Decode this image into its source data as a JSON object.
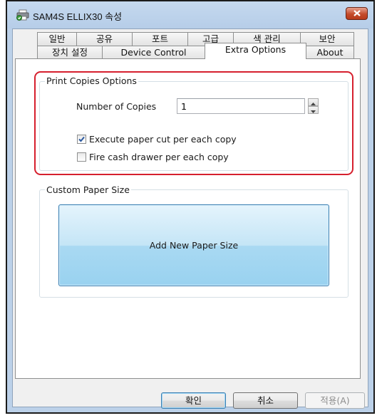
{
  "window": {
    "title": "SAM4S ELLIX30 속성"
  },
  "tabs": {
    "row1": [
      "일반",
      "공유",
      "포트",
      "고급",
      "색 관리",
      "보안"
    ],
    "row2": [
      "장치 설정",
      "Device Control",
      "Extra Options",
      "About"
    ],
    "active": "Extra Options"
  },
  "print_copies": {
    "group_label": "Print Copies Options",
    "number_label": "Number of Copies",
    "number_value": "1",
    "paper_cut_label": "Execute paper cut per each copy",
    "paper_cut_checked": true,
    "cash_drawer_label": "Fire cash drawer per each copy",
    "cash_drawer_checked": false
  },
  "custom_paper": {
    "group_label": "Custom Paper Size",
    "add_button_label": "Add New Paper Size"
  },
  "buttons": {
    "ok": "확인",
    "cancel": "취소",
    "apply": "적용(A)"
  },
  "colors": {
    "highlight": "#d6202e",
    "accent": "#3c7fb1"
  }
}
